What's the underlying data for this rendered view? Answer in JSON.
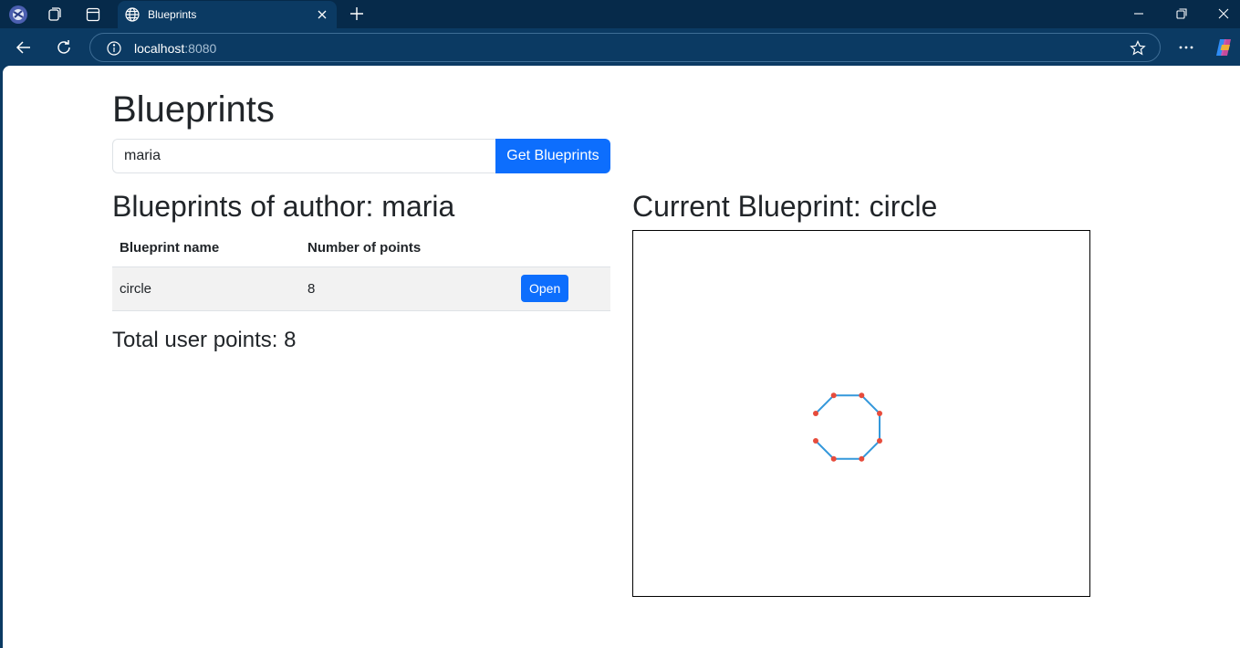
{
  "browser": {
    "tab_title": "Blueprints",
    "url_host": "localhost",
    "url_port": ":8080"
  },
  "page": {
    "title": "Blueprints",
    "author_input_value": "maria",
    "get_button_label": "Get Blueprints",
    "author_heading": "Blueprints of author: maria",
    "current_heading": "Current Blueprint: circle",
    "table": {
      "headers": [
        "Blueprint name",
        "Number of points",
        ""
      ],
      "rows": [
        {
          "name": "circle",
          "points": "8",
          "action": "Open"
        }
      ]
    },
    "total_points": "Total user points: 8"
  },
  "colors": {
    "primary": "#0d6efd",
    "chrome_dark": "#062a4a",
    "chrome": "#0b3a63",
    "line": "#3498db",
    "point": "#e74c3c"
  }
}
